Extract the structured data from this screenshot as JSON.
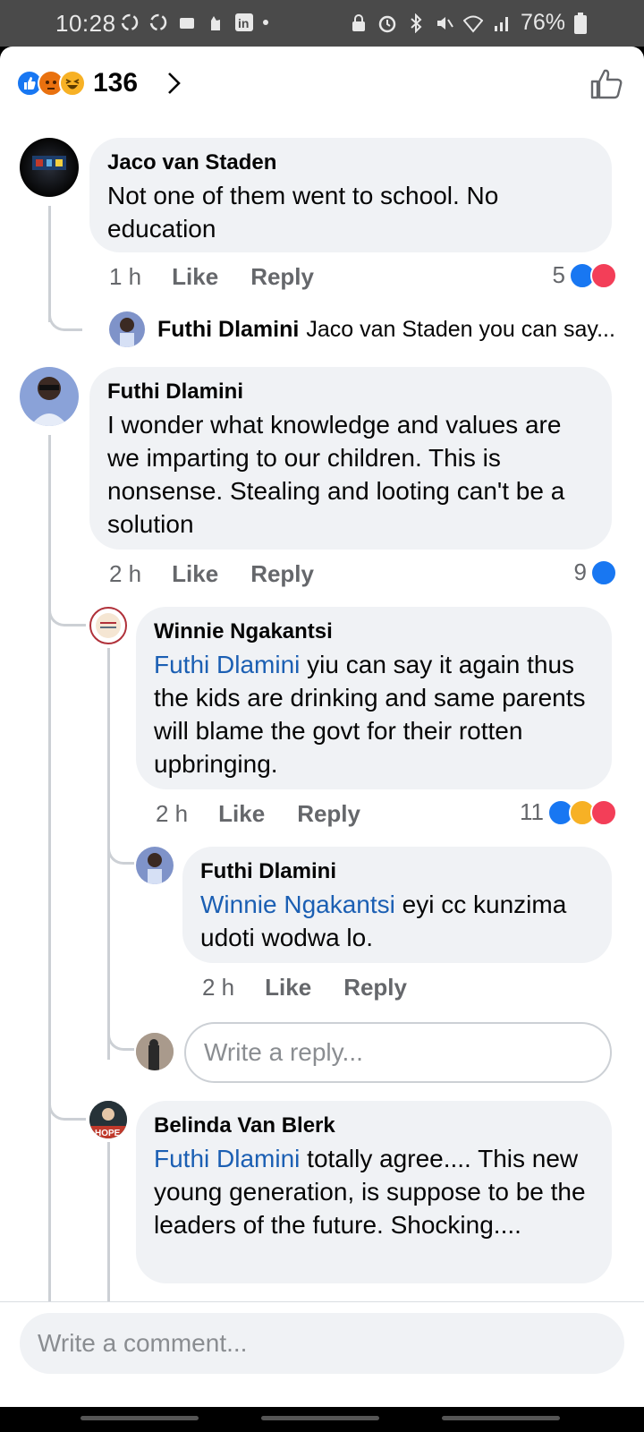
{
  "status_bar": {
    "time": "10:28",
    "battery": "76%"
  },
  "header": {
    "reaction_icons": [
      "like-reaction",
      "angry-reaction",
      "haha-reaction"
    ],
    "reaction_count": "136"
  },
  "comments": [
    {
      "author": "Jaco van Staden",
      "text": "Not one of them went to school. No education",
      "age": "1 h",
      "like": "Like",
      "reply": "Reply",
      "reactions_count": "5",
      "collapsed_reply": {
        "author": "Futhi Dlamini",
        "preview": "Jaco van Staden you can say..."
      }
    },
    {
      "author": "Futhi Dlamini",
      "text": "I wonder what knowledge and values are we imparting to our children. This is nonsense. Stealing and looting can't be a solution",
      "age": "2 h",
      "like": "Like",
      "reply": "Reply",
      "reactions_count": "9",
      "replies": [
        {
          "author": "Winnie Ngakantsi",
          "mention": "Futhi Dlamini",
          "text": " yiu can say it again thus the kids are drinking and same parents will blame the govt for their rotten upbringing.",
          "age": "2 h",
          "like": "Like",
          "reply": "Reply",
          "reactions_count": "11",
          "replies": [
            {
              "author": "Futhi Dlamini",
              "mention": "Winnie Ngakantsi",
              "text": " eyi cc kunzima udoti wodwa lo.",
              "age": "2 h",
              "like": "Like",
              "reply": "Reply"
            }
          ],
          "reply_placeholder": "Write a reply..."
        },
        {
          "author": "Belinda Van Blerk",
          "mention": "Futhi Dlamini",
          "text": " totally agree.... This new young generation, is suppose to be the leaders of the future. Shocking....",
          "avatar_text": "HOPE"
        }
      ]
    }
  ],
  "composer": {
    "placeholder": "Write a comment..."
  },
  "colors": {
    "facebook_blue": "#1877f2",
    "mention_blue": "#1b5fb3",
    "bubble_gray": "#f0f2f5",
    "meta_gray": "#65676b"
  }
}
